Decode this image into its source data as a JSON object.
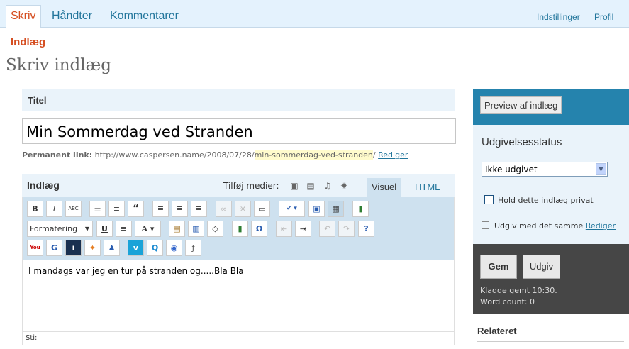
{
  "topnav": {
    "tabs": [
      "Skriv",
      "Håndter",
      "Kommentarer"
    ],
    "right": [
      "Indstillinger",
      "Profil"
    ]
  },
  "subnav": "Indlæg",
  "page_title": "Skriv indlæg",
  "title_section": {
    "label": "Titel",
    "value": "Min Sommerdag ved Stranden"
  },
  "permalink": {
    "label": "Permanent link:",
    "base": "http://www.caspersen.name/2008/07/28/",
    "slug": "min-sommerdag-ved-stranden",
    "trail": "/",
    "edit": "Rediger"
  },
  "editor": {
    "label": "Indlæg",
    "add_media": "Tilføj medier:",
    "tab_visual": "Visuel",
    "tab_html": "HTML",
    "format_select": "Formatering",
    "content": "I mandags var jeg en tur på stranden og.....Bla Bla",
    "path_label": "Sti:"
  },
  "toolbar_icons": {
    "row1": [
      "bold-icon",
      "italic-icon",
      "strikethrough-icon",
      "bullet-list-icon",
      "numbered-list-icon",
      "blockquote-icon",
      "align-left-icon",
      "align-center-icon",
      "align-right-icon",
      "link-icon",
      "unlink-icon",
      "more-icon",
      "spellcheck-icon",
      "fullscreen-icon",
      "kitchen-sink-icon",
      "save-icon"
    ],
    "row2": [
      "underline-icon",
      "justify-icon",
      "text-color-icon",
      "paste-text-icon",
      "paste-word-icon",
      "remove-format-icon",
      "media-icon",
      "special-char-icon",
      "outdent-icon",
      "indent-icon",
      "undo-icon",
      "redo-icon",
      "help-icon"
    ],
    "row3": [
      "youtube-icon",
      "google-video-icon",
      "ifilm-icon",
      "dailymotion-icon",
      "myspace-icon",
      "vimeo-icon",
      "quicktime-icon",
      "realplayer-icon",
      "flash-icon"
    ]
  },
  "sidebar": {
    "preview_button": "Preview af indlæg",
    "status_heading": "Udgivelsesstatus",
    "status_value": "Ikke udgivet",
    "private_label": "Hold dette indlæg privat",
    "publish_immediately": "Udgiv med det samme",
    "publish_edit": "Rediger",
    "save_button": "Gem",
    "publish_button": "Udgiv",
    "draft_saved": "Kladde gemt 10:30.",
    "word_count": "Word count: 0",
    "related_heading": "Relateret"
  },
  "colors": {
    "accent": "#d54e21",
    "link": "#21759b",
    "header_bg": "#e4f2fd",
    "section_bg": "#eaf3fa",
    "toolbar_bg": "#cee1ef",
    "dark_box": "#464646"
  }
}
